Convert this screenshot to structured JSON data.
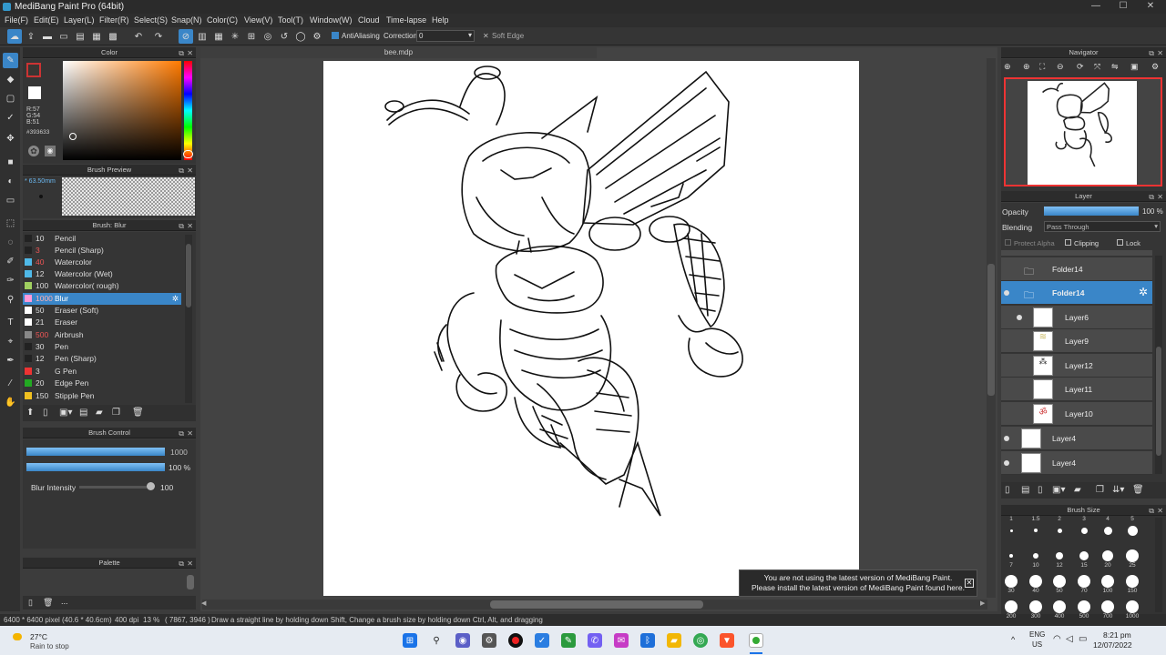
{
  "window": {
    "title": "MediBang Paint Pro (64bit)",
    "controls": [
      "—",
      "☐",
      "✕"
    ]
  },
  "menu": [
    "File(F)",
    "Edit(E)",
    "Layer(L)",
    "Filter(R)",
    "Select(S)",
    "Snap(N)",
    "Color(C)",
    "View(V)",
    "Tool(T)",
    "Window(W)",
    "Cloud",
    "Time-lapse",
    "Help"
  ],
  "toolbar": {
    "antialiasing": "AntiAliasing",
    "correction_label": "Correction",
    "correction_value": "0",
    "soft_edge": "Soft Edge"
  },
  "color_panel": {
    "title": "Color",
    "rgb_r": "R:57",
    "rgb_g": "G:54",
    "rgb_b": "B:51",
    "hex": "#393633",
    "current_color": "#393633",
    "bg_color": "#ffffff"
  },
  "brush_preview": {
    "title": "Brush Preview",
    "size": "63.50mm"
  },
  "brush_list": {
    "title": "Brush: Blur",
    "items": [
      {
        "size": "10",
        "name": "Pencil",
        "color": "#222222"
      },
      {
        "size": "3",
        "name": "Pencil (Sharp)",
        "color": "#222222"
      },
      {
        "size": "40",
        "name": "Watercolor",
        "color": "#4fb9e8"
      },
      {
        "size": "12",
        "name": "Watercolor (Wet)",
        "color": "#4fb9e8"
      },
      {
        "size": "100",
        "name": "Watercolor( rough)",
        "color": "#a0d060"
      },
      {
        "size": "1000",
        "name": "Blur",
        "color": "#ff9ad8"
      },
      {
        "size": "50",
        "name": "Eraser (Soft)",
        "color": "#ffffff"
      },
      {
        "size": "21",
        "name": "Eraser",
        "color": "#ffffff"
      },
      {
        "size": "500",
        "name": "Airbrush",
        "color": "#888888"
      },
      {
        "size": "30",
        "name": "Pen",
        "color": "#222222"
      },
      {
        "size": "12",
        "name": "Pen (Sharp)",
        "color": "#222222"
      },
      {
        "size": "3",
        "name": "G Pen",
        "color": "#ee3333"
      },
      {
        "size": "20",
        "name": "Edge Pen",
        "color": "#22aa22"
      },
      {
        "size": "150",
        "name": "Stipple Pen",
        "color": "#f0c020"
      }
    ]
  },
  "brush_control": {
    "title": "Brush Control",
    "size_value": "1000",
    "opacity_value": "100 %",
    "intensity_label": "Blur Intensity",
    "intensity_value": "100"
  },
  "palette": {
    "title": "Palette",
    "dots": "..."
  },
  "document": {
    "tab": "bee.mdp"
  },
  "notice": {
    "line1": "You are not using the latest version of MediBang Paint.",
    "line2": "Please install the latest version of MediBang Paint found here."
  },
  "navigator": {
    "title": "Navigator"
  },
  "layer_panel": {
    "title": "Layer",
    "opacity_label": "Opacity",
    "opacity_value": "100 %",
    "blending_label": "Blending",
    "blending_value": "Pass Through",
    "protect_alpha": "Protect Alpha",
    "clipping": "Clipping",
    "lock": "Lock",
    "layers": [
      {
        "name": "Folder14",
        "type": "folder"
      },
      {
        "name": "Folder14",
        "type": "folder"
      },
      {
        "name": "Layer6",
        "type": "layer"
      },
      {
        "name": "Layer9",
        "type": "layer"
      },
      {
        "name": "Layer12",
        "type": "layer"
      },
      {
        "name": "Layer11",
        "type": "layer"
      },
      {
        "name": "Layer10",
        "type": "layer"
      },
      {
        "name": "Layer4",
        "type": "layer"
      },
      {
        "name": "Layer4",
        "type": "layer"
      }
    ]
  },
  "brush_size": {
    "title": "Brush Size",
    "labels": [
      "1",
      "1.5",
      "2",
      "3",
      "4",
      "5",
      "7",
      "10",
      "12",
      "15",
      "20",
      "25",
      "30",
      "40",
      "50",
      "70",
      "100",
      "150",
      "200",
      "300",
      "400",
      "500",
      "700",
      "1000"
    ]
  },
  "status": {
    "size": "6400 * 6400 pixel",
    "cm": "(40.6 * 40.6cm)",
    "dpi": "400 dpi",
    "zoom": "13 %",
    "coords": "( 7867, 3946 )",
    "hint": "Draw a straight line by holding down Shift, Change a brush size by holding down Ctrl, Alt, and dragging"
  },
  "taskbar": {
    "temp": "27°C",
    "weather": "Rain to stop",
    "lang1": "ENG",
    "lang2": "US",
    "time": "8:21 pm",
    "date": "12/07/2022"
  }
}
